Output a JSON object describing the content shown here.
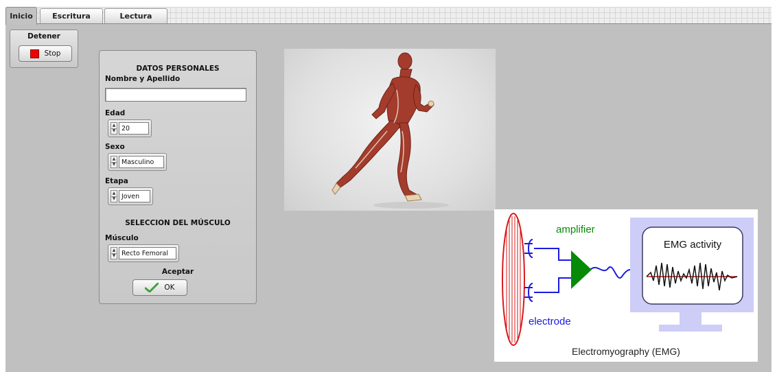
{
  "tabs": [
    "Inicio",
    "Escritura",
    "Lectura"
  ],
  "stop": {
    "title": "Detener",
    "button": "Stop"
  },
  "form": {
    "section_personal": "DATOS PERSONALES",
    "name_label": "Nombre y Apellido",
    "name_value": "",
    "age_label": "Edad",
    "age_value": "20",
    "sex_label": "Sexo",
    "sex_value": "Masculino",
    "stage_label": "Etapa",
    "stage_value": "Joven",
    "section_muscle": "SELECCION DEL MÚSCULO",
    "muscle_label": "Músculo",
    "muscle_value": "Recto Femoral",
    "accept_label": "Aceptar",
    "ok_button": "OK"
  },
  "emg": {
    "amplifier": "amplifier",
    "electrode": "electrode",
    "activity": "EMG activity",
    "caption": "Electromyography (EMG)"
  },
  "colors": {
    "panel": "#c0c0c0",
    "stop_red": "#f00000",
    "amplifier_green": "#078a07",
    "electrode_blue": "#1a1ae0",
    "monitor_lavender": "#cdcdf8"
  }
}
